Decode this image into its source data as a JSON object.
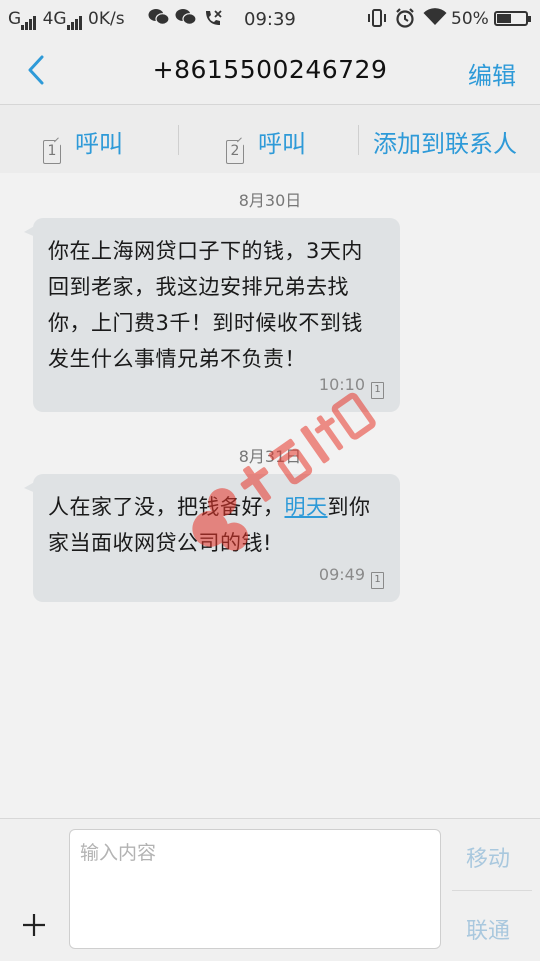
{
  "status_bar": {
    "network_left": "G",
    "network_4g": "4G",
    "speed": "0K/s",
    "time": "09:39",
    "battery": "50%",
    "battery_level": 0.5,
    "icons": [
      "wechat-icon",
      "wechat-icon",
      "missed-call-icon",
      "vibrate-icon",
      "alarm-icon",
      "wifi-icon",
      "battery-icon"
    ]
  },
  "header": {
    "title": "+8615500246729",
    "edit_label": "编辑",
    "back_icon": "chevron-left-icon"
  },
  "actions": {
    "call1_label": "呼叫",
    "call1_sim": "1",
    "call2_label": "呼叫",
    "call2_sim": "2",
    "add_contact_label": "添加到联系人"
  },
  "messages": [
    {
      "date": "8月30日",
      "text": "你在上海网贷口子下的钱，3天内回到老家，我这边安排兄弟去找你，上门费3千！到时候收不到钱发生什么事情兄弟不负责！",
      "time": "10:10",
      "sim": "1"
    },
    {
      "date": "8月31日",
      "text_before": "人在家了没，把钱备好，",
      "link": "明天",
      "text_after": "到你家当面收网贷公司的钱!",
      "time": "09:49",
      "sim": "1"
    }
  ],
  "compose": {
    "placeholder": "输入内容",
    "send_mobile": "移动",
    "send_unicom": "联通"
  },
  "colors": {
    "accent": "#2e9ad8",
    "bubble": "#dfe2e4",
    "background": "#f2f2f2",
    "watermark": "#e8372c"
  }
}
